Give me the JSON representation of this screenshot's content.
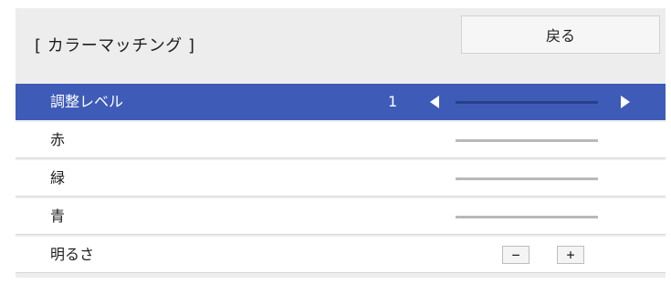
{
  "header": {
    "title": "[ カラーマッチング ]",
    "back_label": "戻る"
  },
  "rows": [
    {
      "label": "調整レベル",
      "value": "1",
      "selected": true
    },
    {
      "label": "赤",
      "slider_level": null
    },
    {
      "label": "緑",
      "slider_level": null
    },
    {
      "label": "青",
      "slider_level": null
    },
    {
      "label": "明るさ",
      "minus_label": "−",
      "plus_label": "+"
    }
  ],
  "colors": {
    "selected_row": "#3e5bb8",
    "panel_bg": "#ededed"
  }
}
